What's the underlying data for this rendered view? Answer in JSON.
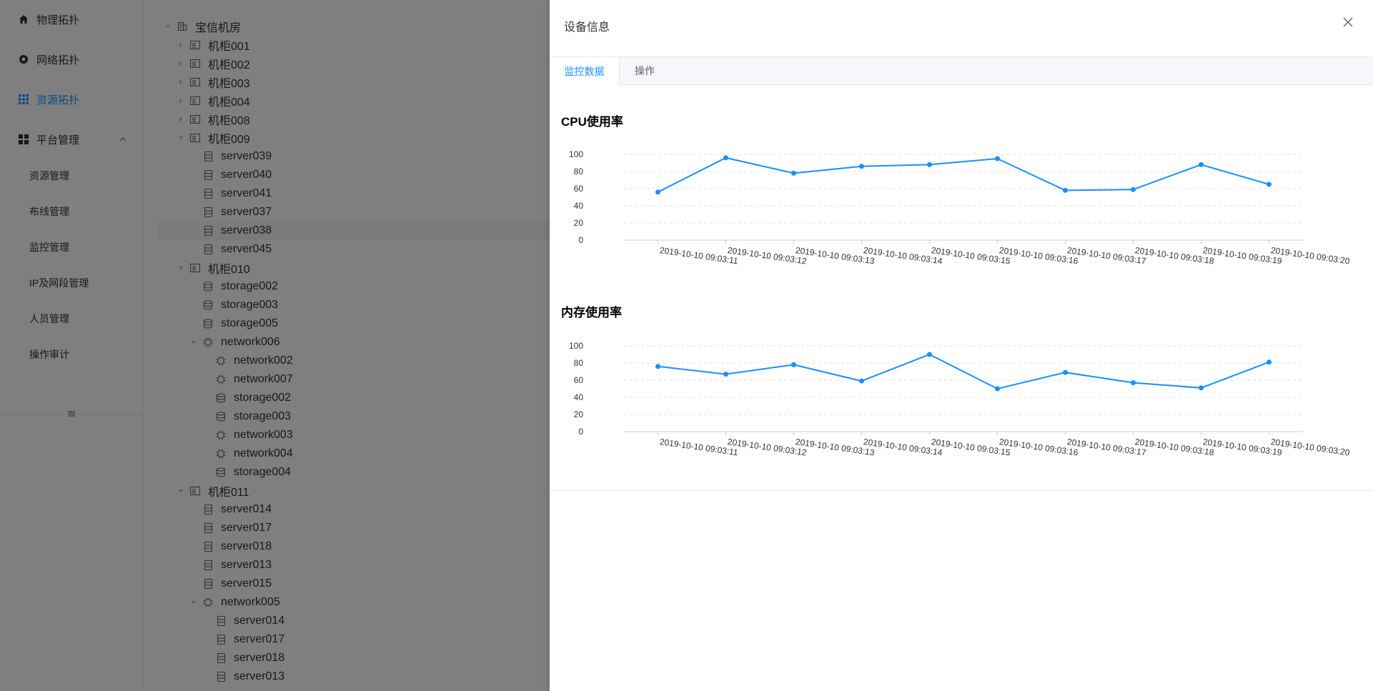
{
  "sidebar": {
    "items": [
      {
        "label": "物理拓扑",
        "icon": "home-icon"
      },
      {
        "label": "网络拓扑",
        "icon": "network-icon"
      },
      {
        "label": "资源拓扑",
        "icon": "grid-icon"
      },
      {
        "label": "平台管理",
        "icon": "dashboard-icon"
      }
    ],
    "sub_items": [
      "资源管理",
      "布线管理",
      "监控管理",
      "IP及网段管理",
      "人员管理",
      "操作审计"
    ],
    "active": "资源拓扑",
    "collapse_icon": "hamburger-icon"
  },
  "tree": [
    {
      "label": "宝信机房",
      "icon": "building-icon",
      "depth": 0,
      "expand": "open"
    },
    {
      "label": "机柜001",
      "icon": "cabinet-icon",
      "depth": 1,
      "expand": "closed"
    },
    {
      "label": "机柜002",
      "icon": "cabinet-icon",
      "depth": 1,
      "expand": "closed"
    },
    {
      "label": "机柜003",
      "icon": "cabinet-icon",
      "depth": 1,
      "expand": "closed"
    },
    {
      "label": "机柜004",
      "icon": "cabinet-icon",
      "depth": 1,
      "expand": "closed"
    },
    {
      "label": "机柜008",
      "icon": "cabinet-icon",
      "depth": 1,
      "expand": "closed"
    },
    {
      "label": "机柜009",
      "icon": "cabinet-icon",
      "depth": 1,
      "expand": "open"
    },
    {
      "label": "server039",
      "icon": "server-icon",
      "depth": 2,
      "expand": "none"
    },
    {
      "label": "server040",
      "icon": "server-icon",
      "depth": 2,
      "expand": "none"
    },
    {
      "label": "server041",
      "icon": "server-icon",
      "depth": 2,
      "expand": "none"
    },
    {
      "label": "server037",
      "icon": "server-icon",
      "depth": 2,
      "expand": "none"
    },
    {
      "label": "server038",
      "icon": "server-icon",
      "depth": 2,
      "expand": "none",
      "highlighted": true
    },
    {
      "label": "server045",
      "icon": "server-icon",
      "depth": 2,
      "expand": "none"
    },
    {
      "label": "机柜010",
      "icon": "cabinet-icon",
      "depth": 1,
      "expand": "open"
    },
    {
      "label": "storage002",
      "icon": "storage-icon",
      "depth": 2,
      "expand": "none"
    },
    {
      "label": "storage003",
      "icon": "storage-icon",
      "depth": 2,
      "expand": "none"
    },
    {
      "label": "storage005",
      "icon": "storage-icon",
      "depth": 2,
      "expand": "none"
    },
    {
      "label": "network006",
      "icon": "chip-icon",
      "depth": 2,
      "expand": "open"
    },
    {
      "label": "network002",
      "icon": "chip-icon",
      "depth": 3,
      "expand": "none"
    },
    {
      "label": "network007",
      "icon": "chip-icon",
      "depth": 3,
      "expand": "none"
    },
    {
      "label": "storage002",
      "icon": "storage-icon",
      "depth": 3,
      "expand": "none"
    },
    {
      "label": "storage003",
      "icon": "storage-icon",
      "depth": 3,
      "expand": "none"
    },
    {
      "label": "network003",
      "icon": "chip-icon",
      "depth": 3,
      "expand": "none"
    },
    {
      "label": "network004",
      "icon": "chip-icon",
      "depth": 3,
      "expand": "none"
    },
    {
      "label": "storage004",
      "icon": "storage-icon",
      "depth": 3,
      "expand": "none"
    },
    {
      "label": "机柜011",
      "icon": "cabinet-icon",
      "depth": 1,
      "expand": "open"
    },
    {
      "label": "server014",
      "icon": "server-icon",
      "depth": 2,
      "expand": "none"
    },
    {
      "label": "server017",
      "icon": "server-icon",
      "depth": 2,
      "expand": "none"
    },
    {
      "label": "server018",
      "icon": "server-icon",
      "depth": 2,
      "expand": "none"
    },
    {
      "label": "server013",
      "icon": "server-icon",
      "depth": 2,
      "expand": "none"
    },
    {
      "label": "server015",
      "icon": "server-icon",
      "depth": 2,
      "expand": "none"
    },
    {
      "label": "network005",
      "icon": "chip-icon",
      "depth": 2,
      "expand": "open"
    },
    {
      "label": "server014",
      "icon": "server-icon",
      "depth": 3,
      "expand": "none"
    },
    {
      "label": "server017",
      "icon": "server-icon",
      "depth": 3,
      "expand": "none"
    },
    {
      "label": "server018",
      "icon": "server-icon",
      "depth": 3,
      "expand": "none"
    },
    {
      "label": "server013",
      "icon": "server-icon",
      "depth": 3,
      "expand": "none"
    }
  ],
  "drawer": {
    "title": "设备信息",
    "close_icon": "close-icon",
    "tabs": [
      "监控数据",
      "操作"
    ],
    "active_tab": "监控数据"
  },
  "colors": {
    "accent": "#1890ff",
    "line": "#1890ff",
    "mask": "rgba(0,0,0,0.5)"
  },
  "chart_data": [
    {
      "type": "line",
      "title": "CPU使用率",
      "x": [
        "2019-10-10 09:03:11",
        "2019-10-10 09:03:12",
        "2019-10-10 09:03:13",
        "2019-10-10 09:03:14",
        "2019-10-10 09:03:15",
        "2019-10-10 09:03:16",
        "2019-10-10 09:03:17",
        "2019-10-10 09:03:18",
        "2019-10-10 09:03:19",
        "2019-10-10 09:03:20"
      ],
      "series": [
        {
          "values": [
            56,
            96,
            78,
            86,
            88,
            95,
            58,
            59,
            88,
            65
          ]
        }
      ],
      "ylim": [
        0,
        100
      ],
      "yticks": [
        0,
        20,
        40,
        60,
        80,
        100
      ],
      "grid": "dashed-horizontal"
    },
    {
      "type": "line",
      "title": "内存使用率",
      "x": [
        "2019-10-10 09:03:11",
        "2019-10-10 09:03:12",
        "2019-10-10 09:03:13",
        "2019-10-10 09:03:14",
        "2019-10-10 09:03:15",
        "2019-10-10 09:03:16",
        "2019-10-10 09:03:17",
        "2019-10-10 09:03:18",
        "2019-10-10 09:03:19",
        "2019-10-10 09:03:20"
      ],
      "series": [
        {
          "values": [
            76,
            67,
            78,
            59,
            90,
            50,
            69,
            57,
            51,
            81
          ]
        }
      ],
      "ylim": [
        0,
        100
      ],
      "yticks": [
        0,
        20,
        40,
        60,
        80,
        100
      ],
      "grid": "dashed-horizontal"
    }
  ]
}
